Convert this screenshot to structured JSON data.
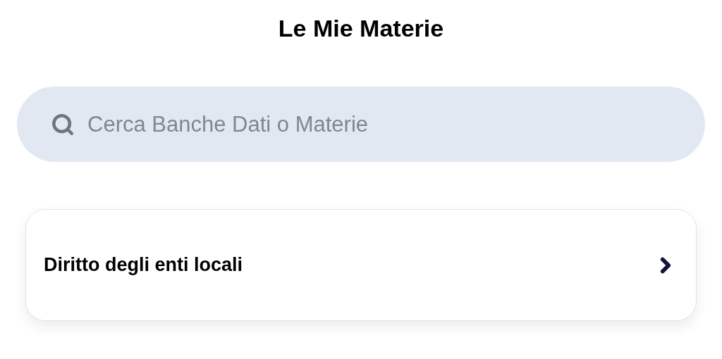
{
  "title": "Le Mie Materie",
  "search": {
    "placeholder": "Cerca Banche Dati o Materie"
  },
  "subjects": [
    {
      "name": "Diritto degli enti locali"
    }
  ]
}
